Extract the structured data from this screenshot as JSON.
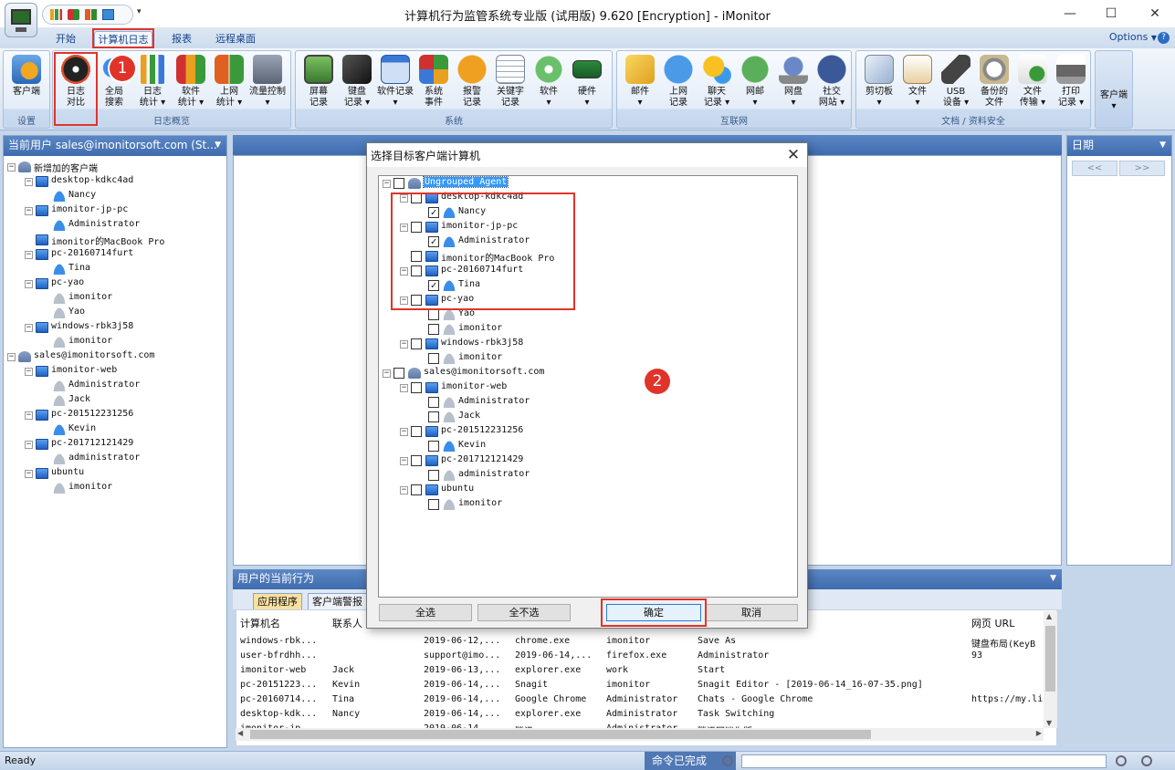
{
  "window": {
    "title": "计算机行为监管系统专业版 (试用版) 9.620 [Encryption] - iMonitor",
    "min": "—",
    "max": "☐",
    "close": "✕"
  },
  "tabs": [
    "开始",
    "计算机日志",
    "报表",
    "远程桌面"
  ],
  "options_label": "Options",
  "options_arrow": "▼",
  "help_label": "?",
  "qat_drop": "▾",
  "ribbon": {
    "groups": [
      {
        "label": "设置",
        "buttons": [
          {
            "label": "客户端"
          }
        ]
      },
      {
        "label": "日志概览",
        "buttons": [
          {
            "label": "日志\n对比"
          },
          {
            "label": "全局\n搜索"
          },
          {
            "label": "日志\n统计 ▾"
          },
          {
            "label": "软件\n统计 ▾"
          },
          {
            "label": "上网\n统计 ▾"
          },
          {
            "label": "流量控制\n▾"
          }
        ]
      },
      {
        "label": "系统",
        "buttons": [
          {
            "label": "屏幕\n记录"
          },
          {
            "label": "键盘\n记录 ▾"
          },
          {
            "label": "软件记录\n▾"
          },
          {
            "label": "系统\n事件"
          },
          {
            "label": "报警\n记录"
          },
          {
            "label": "关键字\n记录"
          },
          {
            "label": "软件\n▾"
          },
          {
            "label": "硬件\n▾"
          }
        ]
      },
      {
        "label": "互联网",
        "buttons": [
          {
            "label": "邮件\n▾"
          },
          {
            "label": "上网\n记录"
          },
          {
            "label": "聊天\n记录 ▾"
          },
          {
            "label": "网邮\n▾"
          },
          {
            "label": "网盘\n▾"
          },
          {
            "label": "社交\n网站 ▾"
          }
        ]
      },
      {
        "label": "文档 / 资料安全",
        "buttons": [
          {
            "label": "剪切板\n▾"
          },
          {
            "label": "文件\n▾"
          },
          {
            "label": "USB\n设备 ▾"
          },
          {
            "label": "备份的\n文件"
          },
          {
            "label": "文件\n传输 ▾"
          },
          {
            "label": "打印\n记录 ▾"
          }
        ]
      },
      {
        "label": "",
        "buttons": [
          {
            "label": "客户端\n▾"
          }
        ]
      }
    ]
  },
  "badges": {
    "one": "1",
    "two": "2"
  },
  "left_pane": {
    "title": "当前用户 sales@imonitorsoft.com (St...",
    "arrow": "▼"
  },
  "tree_minus": "−",
  "check_mark": "✓",
  "tree": [
    {
      "level": 0,
      "type": "grp",
      "text": "新增加的客户端",
      "exp": true
    },
    {
      "level": 1,
      "type": "pc",
      "text": "desktop-kdkc4ad",
      "exp": true
    },
    {
      "level": 2,
      "type": "user",
      "text": "Nancy"
    },
    {
      "level": 1,
      "type": "pc",
      "text": "imonitor-jp-pc",
      "exp": true
    },
    {
      "level": 2,
      "type": "user",
      "text": "Administrator"
    },
    {
      "level": 1,
      "type": "pc",
      "text": "imonitor的MacBook Pro"
    },
    {
      "level": 1,
      "type": "pc",
      "text": "pc-20160714furt",
      "exp": true
    },
    {
      "level": 2,
      "type": "user",
      "text": "Tina"
    },
    {
      "level": 1,
      "type": "pc",
      "text": "pc-yao",
      "exp": true
    },
    {
      "level": 2,
      "type": "user off",
      "text": "imonitor"
    },
    {
      "level": 2,
      "type": "user off",
      "text": "Yao"
    },
    {
      "level": 1,
      "type": "pc",
      "text": "windows-rbk3j58",
      "exp": true
    },
    {
      "level": 2,
      "type": "user off",
      "text": "imonitor"
    },
    {
      "level": 0,
      "type": "grp",
      "text": "sales@imonitorsoft.com",
      "exp": true
    },
    {
      "level": 1,
      "type": "pc",
      "text": "imonitor-web",
      "exp": true
    },
    {
      "level": 2,
      "type": "user off",
      "text": "Administrator"
    },
    {
      "level": 2,
      "type": "user off",
      "text": "Jack"
    },
    {
      "level": 1,
      "type": "pc",
      "text": "pc-201512231256",
      "exp": true
    },
    {
      "level": 2,
      "type": "user",
      "text": "Kevin"
    },
    {
      "level": 1,
      "type": "pc",
      "text": "pc-201712121429",
      "exp": true
    },
    {
      "level": 2,
      "type": "user off",
      "text": "administrator"
    },
    {
      "level": 1,
      "type": "pc",
      "text": "ubuntu",
      "exp": true
    },
    {
      "level": 2,
      "type": "user off",
      "text": "imonitor"
    }
  ],
  "right_pane": {
    "title": "日期",
    "arrow": "▼",
    "prev": "<<",
    "next": ">>"
  },
  "bottom": {
    "title": "用户的当前行为",
    "arrow": "▼",
    "tabs": [
      "应用程序",
      "客户端警报"
    ],
    "headers": [
      "计算机名",
      "联系人",
      "",
      "",
      "",
      "",
      "网页 URL"
    ],
    "rows": [
      [
        "windows-rbk...",
        "",
        "2019-06-12,...",
        "chrome.exe",
        "imonitor",
        "Save As",
        "键盘布局(KeyB"
      ],
      [
        "user-bfrdhh...",
        "",
        "support@imo...",
        "2019-06-14,...",
        "firefox.exe",
        "Administrator",
        "93"
      ],
      [
        "imonitor-web",
        "Jack",
        "2019-06-13,...",
        "explorer.exe",
        "work",
        "Start",
        ""
      ],
      [
        "pc-20151223...",
        "Kevin",
        "2019-06-14,...",
        "Snagit",
        "imonitor",
        "Snagit Editor - [2019-06-14_16-07-35.png]",
        ""
      ],
      [
        "pc-20160714...",
        "Tina",
        "2019-06-14,...",
        "Google Chrome",
        "Administrator",
        "Chats - Google Chrome",
        "https://my.li"
      ],
      [
        "desktop-kdk...",
        "Nancy",
        "2019-06-14,...",
        "explorer.exe",
        "Administrator",
        "Task Switching",
        ""
      ],
      [
        "imonitor-jp...",
        "",
        "2019-06-14,...",
        "腾讯QQ",
        "Administrator",
        "腾讯网迷你版",
        ""
      ]
    ],
    "scroll": {
      "up": "▲",
      "down": "▼",
      "left": "◀",
      "right": "▶"
    }
  },
  "status": {
    "left": "Ready",
    "mid": "命令已完成"
  },
  "dialog": {
    "title": "选择目标客户端计算机",
    "close": "✕",
    "buttons": [
      "全选",
      "全不选",
      "确定",
      "取消"
    ],
    "tree": [
      {
        "level": 0,
        "type": "grp",
        "text": "Ungrouped Agent",
        "checked": false,
        "exp": true,
        "selected": true
      },
      {
        "level": 1,
        "type": "pc",
        "text": "desktop-kdkc4ad",
        "checked": false,
        "exp": true
      },
      {
        "level": 2,
        "type": "user",
        "text": "Nancy",
        "checked": true
      },
      {
        "level": 1,
        "type": "pc",
        "text": "imonitor-jp-pc",
        "checked": false,
        "exp": true
      },
      {
        "level": 2,
        "type": "user",
        "text": "Administrator",
        "checked": true
      },
      {
        "level": 1,
        "type": "pc",
        "text": "imonitor的MacBook Pro",
        "checked": false
      },
      {
        "level": 1,
        "type": "pc",
        "text": "pc-20160714furt",
        "checked": false,
        "exp": true
      },
      {
        "level": 2,
        "type": "user",
        "text": "Tina",
        "checked": true
      },
      {
        "level": 1,
        "type": "pc",
        "text": "pc-yao",
        "checked": false,
        "exp": true
      },
      {
        "level": 2,
        "type": "user off",
        "text": "Yao",
        "checked": false
      },
      {
        "level": 2,
        "type": "user off",
        "text": "imonitor",
        "checked": false
      },
      {
        "level": 1,
        "type": "pc",
        "text": "windows-rbk3j58",
        "checked": false,
        "exp": true
      },
      {
        "level": 2,
        "type": "user off",
        "text": "imonitor",
        "checked": false
      },
      {
        "level": 0,
        "type": "grp",
        "text": "sales@imonitorsoft.com",
        "checked": false,
        "exp": true
      },
      {
        "level": 1,
        "type": "pc",
        "text": "imonitor-web",
        "checked": false,
        "exp": true
      },
      {
        "level": 2,
        "type": "user off",
        "text": "Administrator",
        "checked": false
      },
      {
        "level": 2,
        "type": "user off",
        "text": "Jack",
        "checked": false
      },
      {
        "level": 1,
        "type": "pc",
        "text": "pc-201512231256",
        "checked": false,
        "exp": true
      },
      {
        "level": 2,
        "type": "user",
        "text": "Kevin",
        "checked": false
      },
      {
        "level": 1,
        "type": "pc",
        "text": "pc-201712121429",
        "checked": false,
        "exp": true
      },
      {
        "level": 2,
        "type": "user off",
        "text": "administrator",
        "checked": false
      },
      {
        "level": 1,
        "type": "pc",
        "text": "ubuntu",
        "checked": false,
        "exp": true
      },
      {
        "level": 2,
        "type": "user off",
        "text": "imonitor",
        "checked": false
      }
    ]
  },
  "colors": {
    "accent_red": "#e0342b",
    "header_blue": "#4a76b6",
    "selected_bg": "#3399ff"
  }
}
